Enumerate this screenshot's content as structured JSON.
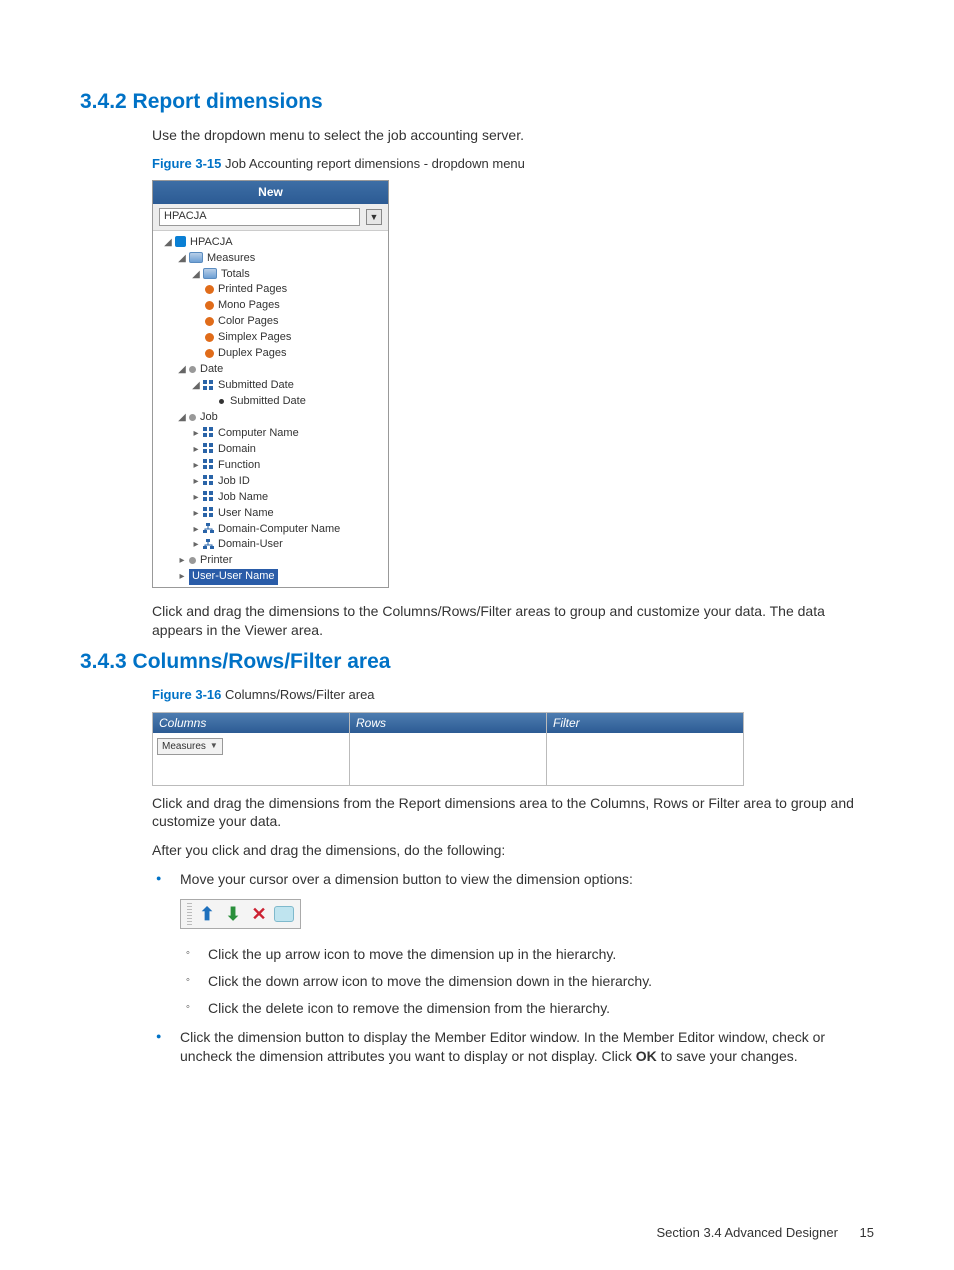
{
  "sections": {
    "s342": {
      "heading": "3.4.2 Report dimensions",
      "intro": "Use the dropdown menu to select the job accounting server.",
      "fig_label": "Figure 3-15",
      "fig_text": "Job Accounting report dimensions - dropdown menu",
      "followup": "Click and drag the dimensions to the Columns/Rows/Filter areas to group and customize your data. The data appears in the Viewer area."
    },
    "s343": {
      "heading": "3.4.3 Columns/Rows/Filter area",
      "fig_label": "Figure 3-16",
      "fig_text": "Columns/Rows/Filter area",
      "p1": "Click and drag the dimensions from the Report dimensions area to the Columns, Rows or Filter area to group and customize your data.",
      "p2": "After you click and drag the dimensions, do the following:",
      "b1": "Move your cursor over a dimension button to view the dimension options:",
      "sub1": "Click the up arrow icon to move the dimension up in the hierarchy.",
      "sub2": "Click the down arrow icon to move the dimension down in the hierarchy.",
      "sub3": "Click the delete icon to remove the dimension from the hierarchy.",
      "b2a": "Click the dimension button to display the Member Editor window. In the Member Editor window, check or uncheck the dimension attributes you want to display or not display. Click ",
      "b2b": "OK",
      "b2c": " to save your changes."
    }
  },
  "tree": {
    "title": "New",
    "selected": "HPACJA",
    "root": "HPACJA",
    "measures": "Measures",
    "totals": "Totals",
    "m": {
      "printed": "Printed Pages",
      "mono": "Mono Pages",
      "color": "Color Pages",
      "simplex": "Simplex Pages",
      "duplex": "Duplex Pages"
    },
    "date_group": "Date",
    "subdate_attr": "Submitted Date",
    "subdate_leaf": "Submitted Date",
    "job_group": "Job",
    "job": {
      "computer": "Computer Name",
      "domain": "Domain",
      "function": "Function",
      "jobid": "Job ID",
      "jobname": "Job Name",
      "username": "User Name",
      "dcn": "Domain-Computer Name",
      "du": "Domain-User"
    },
    "printer_group": "Printer",
    "selected_node": "User-User Name"
  },
  "crf": {
    "columns": "Columns",
    "rows": "Rows",
    "filter": "Filter",
    "pill": "Measures"
  },
  "footer": {
    "section": "Section 3.4   Advanced Designer",
    "page": "15"
  }
}
